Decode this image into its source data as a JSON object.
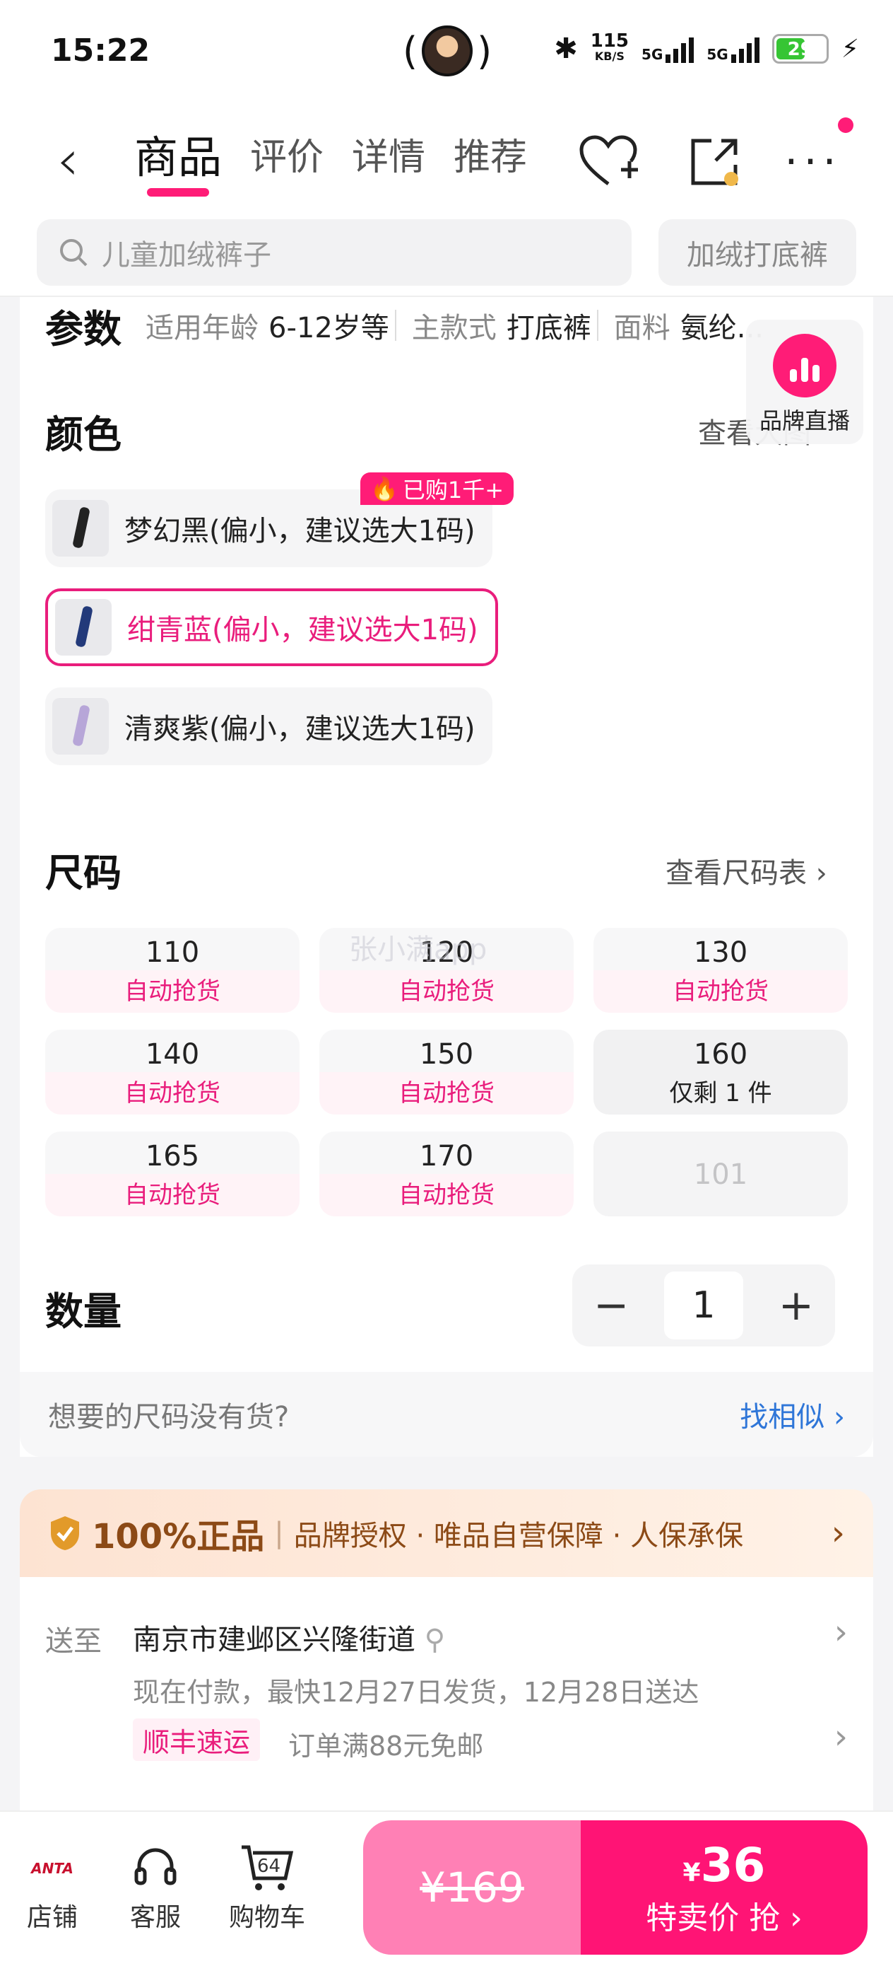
{
  "status": {
    "time": "15:22",
    "net_speed": "115",
    "net_unit": "KB/S",
    "sig1": "5G",
    "sig2": "5G",
    "battery": "29"
  },
  "nav": {
    "tabs": [
      "商品",
      "评价",
      "详情",
      "推荐"
    ],
    "active_tab": 0
  },
  "search": {
    "placeholder": "儿童加绒裤子",
    "chip": "加绒打底裤"
  },
  "params": {
    "label": "参数",
    "items": [
      {
        "k": "适用年龄",
        "v": "6-12岁等"
      },
      {
        "k": "主款式",
        "v": "打底裤"
      },
      {
        "k": "面料",
        "v": "氨纶..."
      }
    ]
  },
  "live": {
    "label": "品牌直播"
  },
  "color": {
    "title": "颜色",
    "view_all": "查看大图",
    "hot_badge": "已购1千+",
    "items": [
      {
        "label": "梦幻黑(偏小，建议选大1码)",
        "selected": false
      },
      {
        "label": "绀青蓝(偏小，建议选大1码)",
        "selected": true
      },
      {
        "label": "清爽紫(偏小，建议选大1码)",
        "selected": false
      }
    ]
  },
  "size": {
    "title": "尺码",
    "chart_link": "查看尺码表",
    "items": [
      {
        "n": "110",
        "s": "自动抢货"
      },
      {
        "n": "120",
        "s": "自动抢货"
      },
      {
        "n": "130",
        "s": "自动抢货"
      },
      {
        "n": "140",
        "s": "自动抢货"
      },
      {
        "n": "150",
        "s": "自动抢货"
      },
      {
        "n": "160",
        "s": "仅剩 1 件"
      },
      {
        "n": "165",
        "s": "自动抢货"
      },
      {
        "n": "170",
        "s": "自动抢货"
      },
      {
        "n": "101",
        "s": ""
      }
    ],
    "watermark": "张小满app"
  },
  "quantity": {
    "title": "数量",
    "value": "1"
  },
  "similar": {
    "question": "想要的尺码没有货?",
    "action": "找相似"
  },
  "guarantee": {
    "badge": "100%正品",
    "text": "品牌授权 · 唯品自营保障 · 人保承保"
  },
  "delivery": {
    "key": "送至",
    "address": "南京市建邺区兴隆街道",
    "eta": "现在付款，最快12月27日发货，12月28日送达",
    "carrier": "顺丰速运",
    "free_ship": "订单满88元免邮"
  },
  "bottom": {
    "shop": "店铺",
    "service": "客服",
    "cart": "购物车",
    "cart_count": "64",
    "brand": "ANTA"
  },
  "buy": {
    "orig_price": "¥169",
    "currency": "¥",
    "price": "36",
    "label": "特卖价 抢 ›"
  },
  "colors": {
    "accent": "#ff1c77",
    "link": "#2f76d8"
  }
}
